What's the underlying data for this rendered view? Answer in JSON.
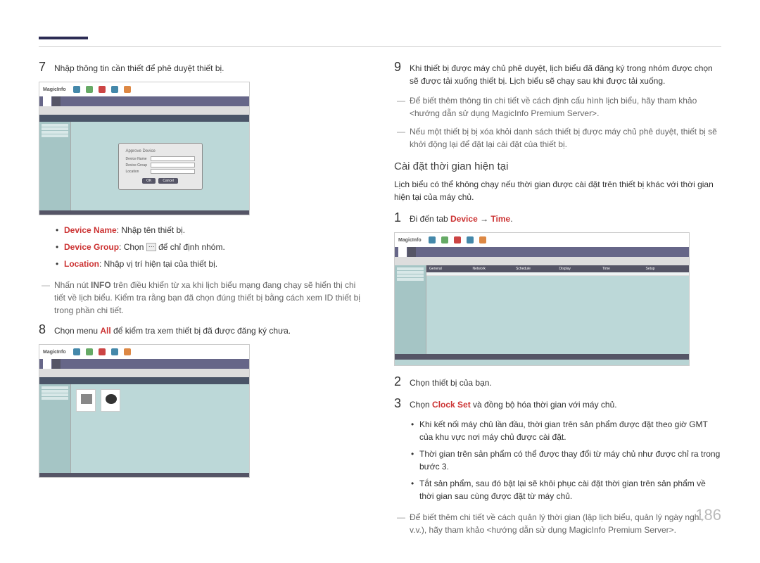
{
  "header": {},
  "left": {
    "step7": {
      "num": "7",
      "text": "Nhập thông tin cần thiết để phê duyệt thiết bị."
    },
    "screenshot1": {
      "app": "MagicInfo",
      "dialog_title": "Approve Device",
      "field1_label": "Device Name",
      "field2_label": "Device Group",
      "field3_label": "Location",
      "btn_ok": "OK",
      "btn_cancel": "Cancel"
    },
    "bullets": {
      "b1_label": "Device Name",
      "b1_sep": ": ",
      "b1_text": "Nhập tên thiết bị.",
      "b2_label": "Device Group",
      "b2_sep": ": Chọn ",
      "b2_text": " để chỉ định nhóm.",
      "b3_label": "Location",
      "b3_sep": ": ",
      "b3_text": "Nhập vị trí hiện tại của thiết bị."
    },
    "note1_a": "Nhấn nút ",
    "note1_b": "INFO",
    "note1_c": " trên điều khiển từ xa khi lịch biểu mạng đang chạy sẽ hiển thị chi tiết về lịch biểu. Kiểm tra rằng bạn đã chọn đúng thiết bị bằng cách xem ID thiết bị trong phần chi tiết.",
    "step8": {
      "num": "8",
      "text_a": "Chọn menu ",
      "text_b": "All",
      "text_c": " để kiểm tra xem thiết bị đã được đăng ký chưa."
    },
    "screenshot2": {
      "app": "MagicInfo"
    }
  },
  "right": {
    "step9": {
      "num": "9",
      "text": "Khi thiết bị được máy chủ phê duyệt, lịch biểu đã đăng ký trong nhóm được chọn sẽ được tải xuống thiết bị. Lịch biểu sẽ chạy sau khi được tải xuống."
    },
    "note1": "Để biết thêm thông tin chi tiết về cách định cấu hình lịch biểu, hãy tham khảo <hướng dẫn sử dụng MagicInfo Premium Server>.",
    "note2": "Nếu một thiết bị bị xóa khỏi danh sách thiết bị được máy chủ phê duyệt, thiết bị sẽ khởi động lại để đặt lại cài đặt của thiết bị.",
    "section_title": "Cài đặt thời gian hiện tại",
    "section_desc": "Lịch biểu có thể không chạy nếu thời gian được cài đặt trên thiết bị khác với thời gian hiện tại của máy chủ.",
    "step1": {
      "num": "1",
      "text_a": "Đi đến tab ",
      "text_b": "Device",
      "text_c": " → ",
      "text_d": "Time",
      "text_e": "."
    },
    "screenshot3": {
      "app": "MagicInfo",
      "tabs": [
        "General",
        "Network",
        "Schedule",
        "Display",
        "Time",
        "Setup"
      ]
    },
    "step2": {
      "num": "2",
      "text": "Chọn thiết bị của bạn."
    },
    "step3": {
      "num": "3",
      "text_a": "Chọn ",
      "text_b": "Clock Set",
      "text_c": " và đồng bộ hóa thời gian với máy chủ."
    },
    "bullets": {
      "b1": "Khi kết nối máy chủ lần đầu, thời gian trên sản phẩm được đặt theo giờ GMT của khu vực nơi máy chủ được cài đặt.",
      "b2": "Thời gian trên sản phẩm có thể được thay đổi từ máy chủ như được chỉ ra trong bước 3.",
      "b3": "Tắt sản phẩm, sau đó bật lại sẽ khôi phục cài đặt thời gian trên sản phẩm về thời gian sau cùng được đặt từ máy chủ."
    },
    "note3": "Để biết thêm chi tiết về cách quản lý thời gian (lập lịch biểu, quản lý ngày nghỉ, v.v.), hãy tham khảo <hướng dẫn sử dụng MagicInfo Premium Server>."
  },
  "page_number": "186"
}
